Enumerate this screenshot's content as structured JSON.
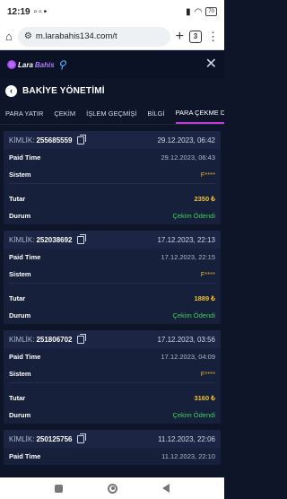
{
  "status_bar": {
    "time": "12:19",
    "battery": "70"
  },
  "browser": {
    "url": "m.larabahis134.com/t",
    "tab_count": "3"
  },
  "app": {
    "logo_lara": "Lara",
    "logo_bahis": "Bahis"
  },
  "page": {
    "title": "BAKİYE YÖNETİMİ"
  },
  "tabs": [
    {
      "label": "PARA YATIR"
    },
    {
      "label": "ÇEKİM"
    },
    {
      "label": "İŞLEM GEÇMİŞİ"
    },
    {
      "label": "BİLGİ"
    },
    {
      "label": "PARA ÇEKME DU"
    }
  ],
  "labels": {
    "kimlik": "KİMLİK:",
    "paid_time": "Paid Time",
    "sistem": "Sistem",
    "tutar": "Tutar",
    "durum": "Durum"
  },
  "transactions": [
    {
      "id": "255685559",
      "date": "29.12.2023, 06:42",
      "paid_time": "29.12.2023, 06:43",
      "sistem": "F****",
      "tutar": "2350 ₺",
      "durum": "Çekim Ödendi"
    },
    {
      "id": "252038692",
      "date": "17.12.2023, 22:13",
      "paid_time": "17.12.2023, 22:15",
      "sistem": "F****",
      "tutar": "1889 ₺",
      "durum": "Çekim Ödendi"
    },
    {
      "id": "251806702",
      "date": "17.12.2023, 03:56",
      "paid_time": "17.12.2023, 04:09",
      "sistem": "F****",
      "tutar": "3160 ₺",
      "durum": "Çekim Ödendi"
    },
    {
      "id": "250125756",
      "date": "11.12.2023, 22:06",
      "paid_time": "11.12.2023, 22:10"
    }
  ]
}
